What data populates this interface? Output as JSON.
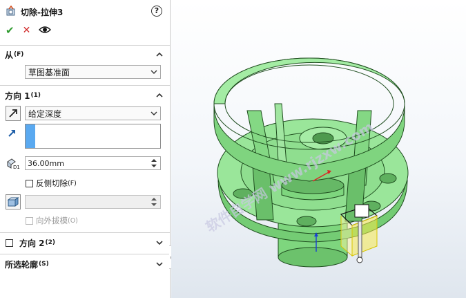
{
  "feature": {
    "title": "切除-拉伸3",
    "help_label": "?"
  },
  "actions": {
    "ok_icon": "check-icon",
    "cancel_icon": "close-icon",
    "preview_icon": "eye-icon"
  },
  "from": {
    "header": "从",
    "header_key": "(F)",
    "value": "草图基准面"
  },
  "direction1": {
    "header": "方向 1",
    "header_key": "(1)",
    "end_condition": "给定深度",
    "depth": "36.00mm",
    "depth_icon_label": "D1",
    "flip_side_cut": {
      "label": "反侧切除",
      "key": "(F)",
      "checked": false
    },
    "draft_outward": {
      "label": "向外拔模",
      "key": "(O)",
      "checked": false,
      "enabled": false
    }
  },
  "direction2": {
    "header": "方向 2",
    "header_key": "(2)",
    "checked": false
  },
  "selected_contours": {
    "header": "所选轮廓",
    "header_key": "(S)"
  },
  "viewport": {
    "watermark": "软件自学网 www.rjzxw.com",
    "colors": {
      "part": "#8fe08f",
      "part_edge": "#1f4d1f",
      "preview": "#f2e24a",
      "bg": "#f3f6fa"
    }
  }
}
